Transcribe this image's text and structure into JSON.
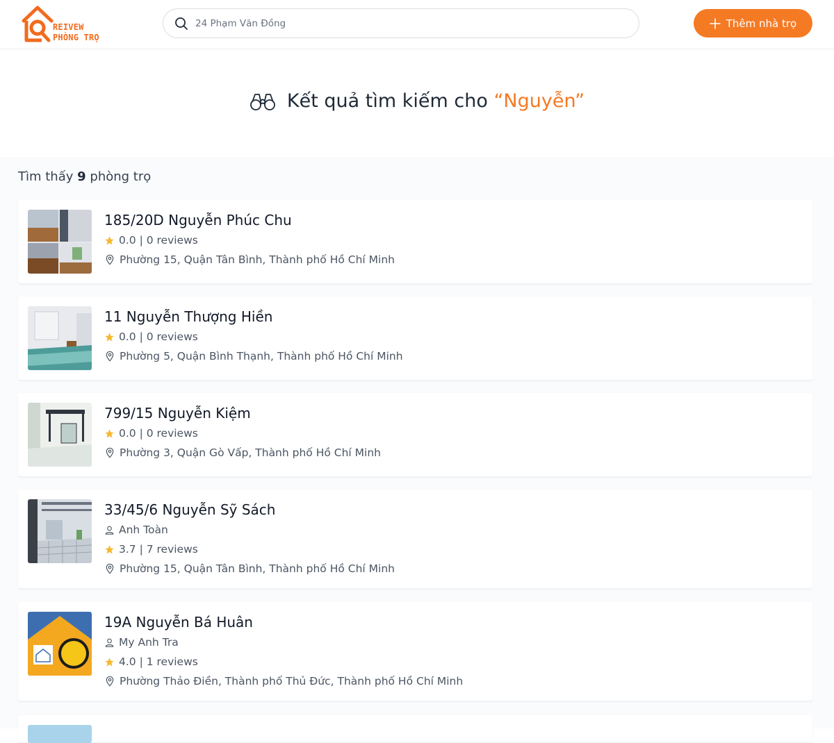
{
  "brand": {
    "line1": "REIVEW",
    "line2": "PHÒNG TRỌ",
    "color": "#f26b1d"
  },
  "search": {
    "placeholder": "24 Phạm Văn Đồng",
    "value": ""
  },
  "add_button": {
    "label": "Thêm nhà trọ"
  },
  "results_title": {
    "prefix": "Kết quả tìm kiếm cho",
    "query": "“Nguyễn”"
  },
  "count": {
    "prefix": "Tìm thấy",
    "number": "9",
    "suffix": "phòng trọ"
  },
  "accent_color": "#f47a24",
  "listings": [
    {
      "name": "185/20D Nguyễn Phúc Chu",
      "owner": null,
      "rating": "0.0 | 0 reviews",
      "address": "Phường 15, Quận Tân Bình, Thành phố Hồ Chí Minh"
    },
    {
      "name": "11 Nguyễn Thượng Hiền",
      "owner": null,
      "rating": "0.0 | 0 reviews",
      "address": "Phường 5, Quận Bình Thạnh, Thành phố Hồ Chí Minh"
    },
    {
      "name": "799/15 Nguyễn Kiệm",
      "owner": null,
      "rating": "0.0 | 0 reviews",
      "address": "Phường 3, Quận Gò Vấp, Thành phố Hồ Chí Minh"
    },
    {
      "name": "33/45/6 Nguyễn Sỹ Sách",
      "owner": "Anh Toàn",
      "rating": "3.7 | 7 reviews",
      "address": "Phường 15, Quận Tân Bình, Thành phố Hồ Chí Minh"
    },
    {
      "name": "19A Nguyễn Bá Huân",
      "owner": "My Anh Tra",
      "rating": "4.0 | 1 reviews",
      "address": "Phường Thảo Điền, Thành phố Thủ Đức, Thành phố Hồ Chí Minh"
    }
  ]
}
